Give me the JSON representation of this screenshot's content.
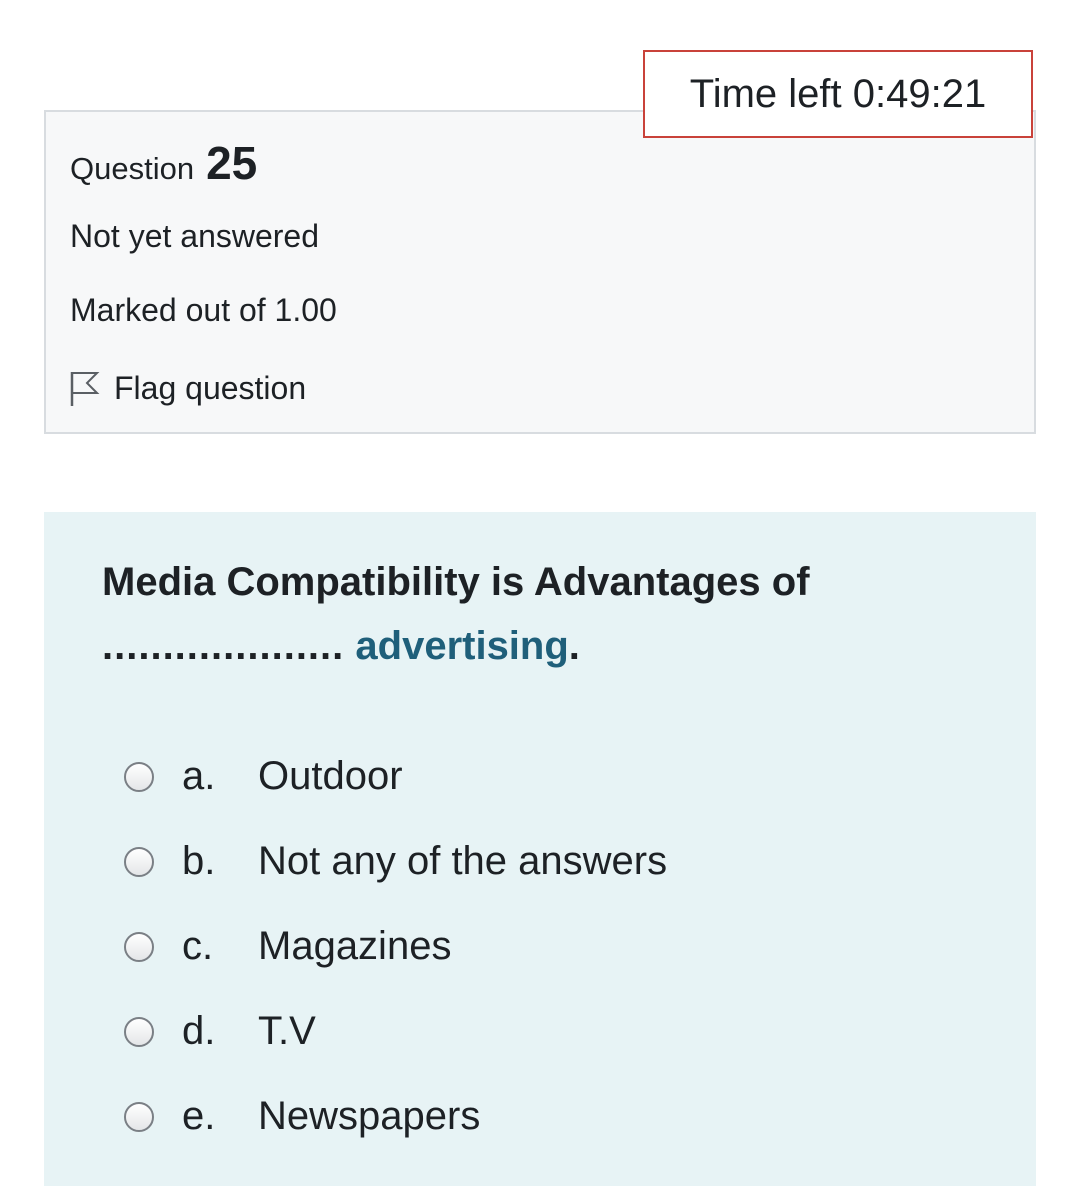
{
  "timer": {
    "label": "Time left",
    "value": "0:49:21"
  },
  "question_info": {
    "label": "Question",
    "number": "25",
    "state": "Not yet answered",
    "grade": "Marked out of 1.00",
    "flag_label": "Flag question",
    "flag_icon": "flag-outline-icon"
  },
  "question": {
    "text_start": "Media Compatibility is Advantages of",
    "blank": "....................",
    "link_word": "advertising",
    "text_end": ".",
    "options": [
      {
        "letter": "a.",
        "text": "Outdoor",
        "selected": false
      },
      {
        "letter": "b.",
        "text": "Not any of the answers",
        "selected": false
      },
      {
        "letter": "c.",
        "text": "Magazines",
        "selected": false
      },
      {
        "letter": "d.",
        "text": "T.V",
        "selected": false
      },
      {
        "letter": "e.",
        "text": "Newspapers",
        "selected": false
      }
    ]
  },
  "colors": {
    "timer_border": "#c9423a",
    "info_background": "#f7f8f9",
    "content_background": "#e7f3f5",
    "link": "#1f5f7a"
  }
}
